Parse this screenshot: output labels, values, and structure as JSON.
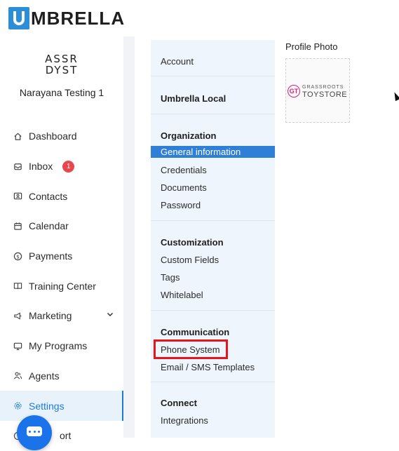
{
  "app": {
    "logo_text": "MBRELLA"
  },
  "account": {
    "avatar_line1": "ASSR",
    "avatar_line2": "DYST",
    "name": "Narayana Testing 1"
  },
  "nav": {
    "items": [
      {
        "label": "Dashboard",
        "icon": "home-icon"
      },
      {
        "label": "Inbox",
        "icon": "inbox-icon",
        "badge": "1"
      },
      {
        "label": "Contacts",
        "icon": "contacts-icon"
      },
      {
        "label": "Calendar",
        "icon": "calendar-icon"
      },
      {
        "label": "Payments",
        "icon": "dollar-icon"
      },
      {
        "label": "Training Center",
        "icon": "book-icon"
      },
      {
        "label": "Marketing",
        "icon": "megaphone-icon"
      },
      {
        "label": "My Programs",
        "icon": "monitor-icon"
      },
      {
        "label": "Agents",
        "icon": "users-icon"
      },
      {
        "label": "Settings",
        "icon": "gear-icon"
      },
      {
        "label": "ort",
        "icon": "help-icon"
      }
    ]
  },
  "settings_menu": {
    "account": "Account",
    "umbrella_local": "Umbrella Local",
    "organization": {
      "title": "Organization",
      "links": [
        "General information",
        "Credentials",
        "Documents",
        "Password"
      ]
    },
    "customization": {
      "title": "Customization",
      "links": [
        "Custom Fields",
        "Tags",
        "Whitelabel"
      ]
    },
    "communication": {
      "title": "Communication",
      "links": [
        "Phone System",
        "Email / SMS Templates"
      ]
    },
    "connect": {
      "title": "Connect",
      "links": [
        "Integrations"
      ]
    }
  },
  "profile": {
    "photo_label": "Profile Photo",
    "logo_mark": "GT",
    "logo_line1": "GRASSROOTS",
    "logo_line2": "TOYSTORE"
  },
  "colors": {
    "accent": "#1d7bd7",
    "selected_row": "#2f7fd6",
    "highlight_box": "#e8141c",
    "badge": "#e8484d"
  }
}
